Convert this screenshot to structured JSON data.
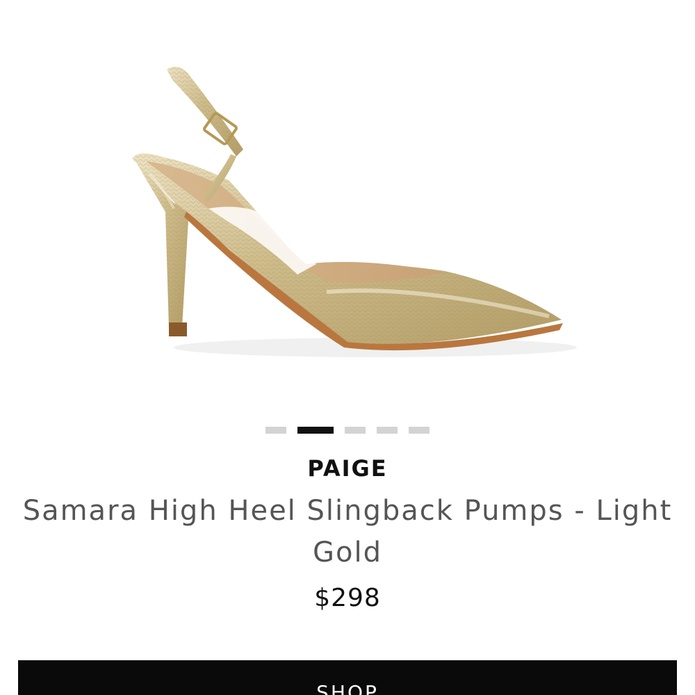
{
  "product": {
    "image_alt": "product image of gold slingback pump",
    "carousel": {
      "total": 5,
      "active_index": 1
    },
    "brand": "PAIGE",
    "title": "Samara High Heel Slingback Pumps - Light Gold",
    "price": "$298"
  },
  "actions": {
    "shop_label": "SHOP"
  }
}
